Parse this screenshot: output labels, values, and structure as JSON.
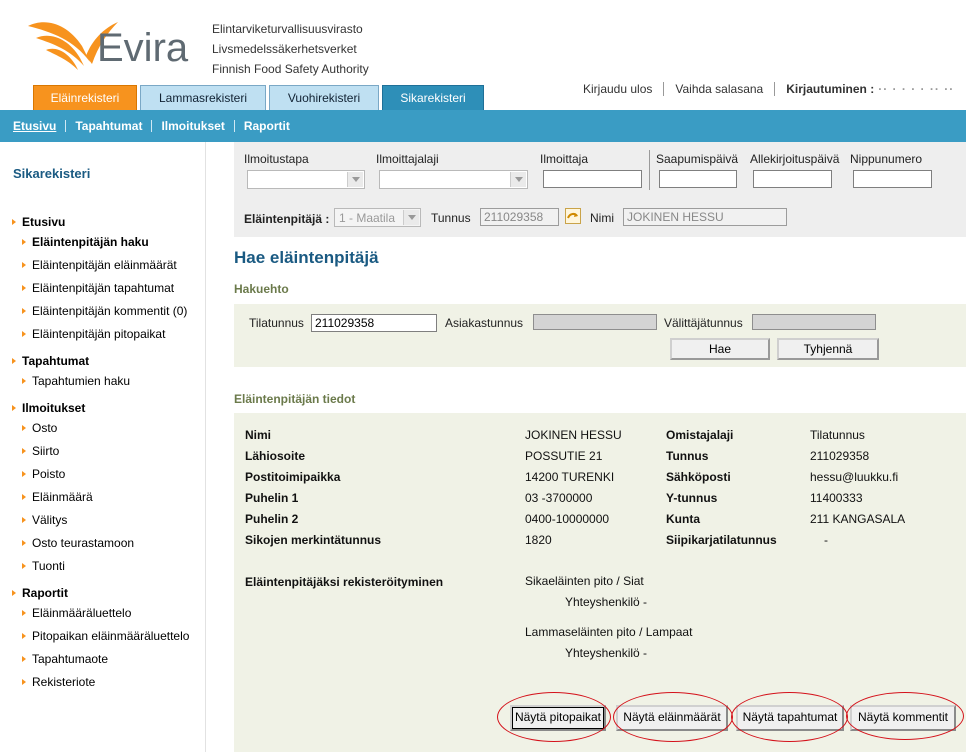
{
  "header": {
    "logo_text": "Evira",
    "org_names": [
      "Elintarviketurvallisuusvirasto",
      "Livsmedelssäkerhetsverket",
      "Finnish Food Safety Authority"
    ],
    "logout": "Kirjaudu ulos",
    "change_password": "Vaihda salasana",
    "login_label": "Kirjautuminen :",
    "login_user_masked": "·· · · · · ·· ··"
  },
  "tabs": [
    {
      "label": "Eläinrekisteri"
    },
    {
      "label": "Lammasrekisteri"
    },
    {
      "label": "Vuohirekisteri"
    },
    {
      "label": "Sikarekisteri"
    }
  ],
  "subnav": [
    "Etusivu",
    "Tapahtumat",
    "Ilmoitukset",
    "Raportit"
  ],
  "sidebar": {
    "title": "Sikarekisteri",
    "groups": [
      {
        "label": "Etusivu",
        "items": [
          "Eläintenpitäjän haku",
          "Eläintenpitäjän eläinmäärät",
          "Eläintenpitäjän tapahtumat",
          "Eläintenpitäjän kommentit (0)",
          "Eläintenpitäjän pitopaikat"
        ]
      },
      {
        "label": "Tapahtumat",
        "items": [
          "Tapahtumien haku"
        ]
      },
      {
        "label": "Ilmoitukset",
        "items": [
          "Osto",
          "Siirto",
          "Poisto",
          "Eläinmäärä",
          "Välitys",
          "Osto teurastamoon",
          "Tuonti"
        ]
      },
      {
        "label": "Raportit",
        "items": [
          "Eläinmääräluettelo",
          "Pitopaikan eläinmääräluettelo",
          "Tapahtumaote",
          "Rekisteriote"
        ]
      }
    ]
  },
  "filter": {
    "ilmoitustapa": "Ilmoitustapa",
    "ilmoittajalaji": "Ilmoittajalaji",
    "ilmoittaja": "Ilmoittaja",
    "saapumispaiva": "Saapumispäivä",
    "allekirjoituspaiva": "Allekirjoituspäivä",
    "nippunumero": "Nippunumero",
    "elaintenpitaja_label": "Eläintenpitäjä :",
    "elaintenpitaja_value": "1 - Maatila",
    "tunnus_label": "Tunnus",
    "tunnus_value": "211029358",
    "nimi_label": "Nimi",
    "nimi_value": "JOKINEN HESSU"
  },
  "search": {
    "page_title": "Hae eläintenpitäjä",
    "section": "Hakuehto",
    "tilatunnus_label": "Tilatunnus",
    "tilatunnus_value": "211029358",
    "asiakastunnus_label": "Asiakastunnus",
    "valittajatunnus_label": "Välittäjätunnus",
    "search_button": "Hae",
    "clear_button": "Tyhjennä"
  },
  "info": {
    "section": "Eläintenpitäjän tiedot",
    "rows": [
      {
        "l1": "Nimi",
        "v1": "JOKINEN HESSU",
        "l2": "Omistajalaji",
        "v2": "Tilatunnus"
      },
      {
        "l1": "Lähiosoite",
        "v1": "POSSUTIE 21",
        "l2": "Tunnus",
        "v2": "211029358"
      },
      {
        "l1": "Postitoimipaikka",
        "v1": "14200 TURENKI",
        "l2": "Sähköposti",
        "v2": "hessu@luukku.fi"
      },
      {
        "l1": "Puhelin 1",
        "v1": "03 -3700000",
        "l2": "Y-tunnus",
        "v2": "11400333"
      },
      {
        "l1": "Puhelin 2",
        "v1": "0400-10000000",
        "l2": "Kunta",
        "v2": "211 KANGASALA"
      },
      {
        "l1": "Sikojen merkintätunnus",
        "v1": "1820",
        "l2": "Siipikarjatilatunnus",
        "v2": "-"
      }
    ],
    "registration_label": "Eläintenpitäjäksi rekisteröityminen",
    "reg1_title": "Sikaeläinten pito / Siat",
    "reg1_contact": "Yhteyshenkilö -",
    "reg2_title": "Lammaseläinten pito / Lampaat",
    "reg2_contact": "Yhteyshenkilö -"
  },
  "actions": [
    "Näytä pitopaikat",
    "Näytä eläinmäärät",
    "Näytä tapahtumat",
    "Näytä kommentit"
  ],
  "colors": {
    "accent_orange": "#f7931e",
    "nav_blue": "#3a9cc4",
    "title_blue": "#1a5a82",
    "highlight_red": "#d4121b"
  }
}
